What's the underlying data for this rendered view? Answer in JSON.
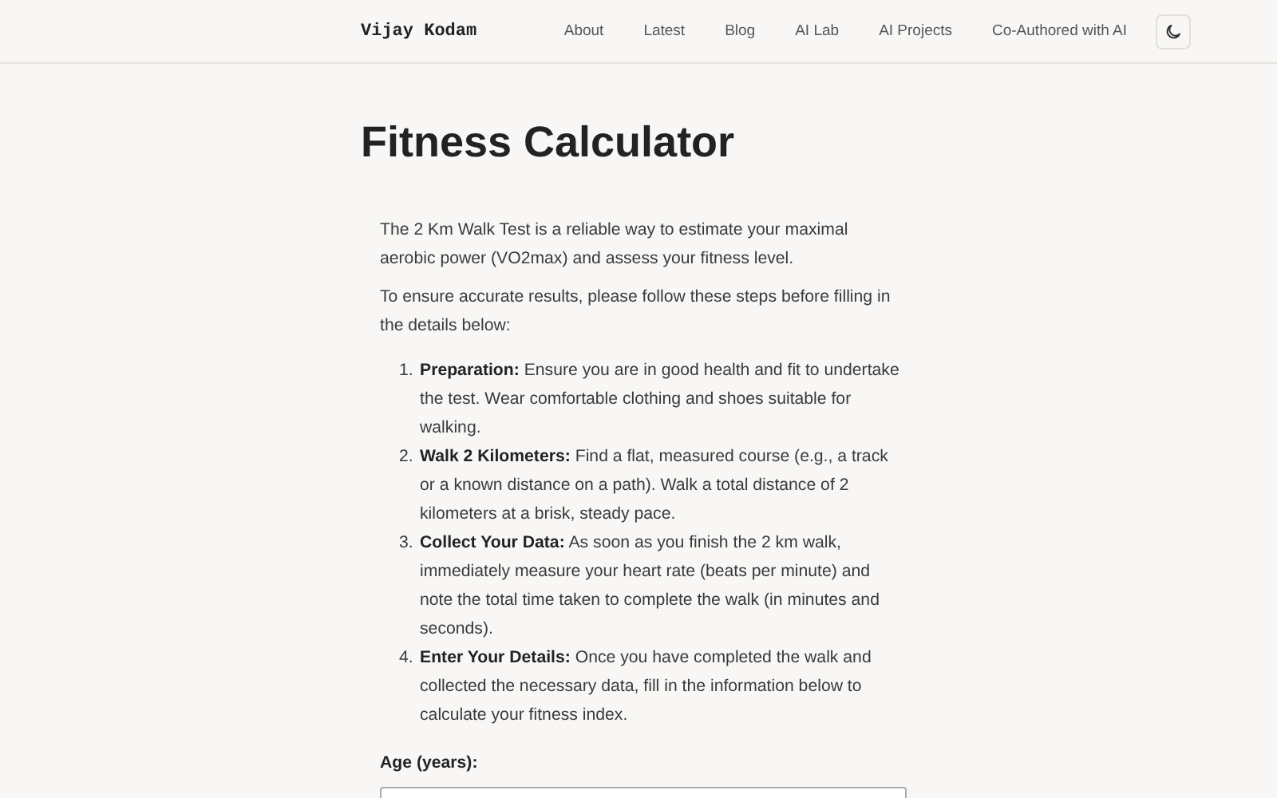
{
  "header": {
    "site_name": "Vijay Kodam",
    "nav": [
      {
        "label": "About"
      },
      {
        "label": "Latest"
      },
      {
        "label": "Blog"
      },
      {
        "label": "AI Lab"
      },
      {
        "label": "AI Projects"
      },
      {
        "label": "Co-Authored with AI"
      }
    ]
  },
  "title": "Fitness Calculator",
  "intro": [
    "The 2 Km Walk Test is a reliable way to estimate your maximal aerobic power (VO2max) and assess your fitness level.",
    "To ensure accurate results, please follow these steps before filling in the details below:"
  ],
  "steps": [
    {
      "number": "1.",
      "text": "**Preparation:** Ensure you are in good health and fit to undertake the test. Wear comfortable clothing and shoes suitable for walking."
    },
    {
      "number": "2.",
      "text": "**Walk 2 Kilometers:** Find a flat, measured course (e.g., a track or a known distance on a path). Walk a total distance of 2 kilometers at a brisk, steady pace."
    },
    {
      "number": "3.",
      "text": "**Collect Your Data:** As soon as you finish the 2 km walk, immediately measure your heart rate (beats per minute) and note the total time taken to complete the walk (in minutes and seconds)."
    },
    {
      "number": "4.",
      "text": "**Enter Your Details:** Once you have completed the walk and collected the necessary data, fill in the information below to calculate your fitness index."
    }
  ],
  "form": {
    "fields": [
      {
        "label": "Age (years):"
      }
    ]
  }
}
